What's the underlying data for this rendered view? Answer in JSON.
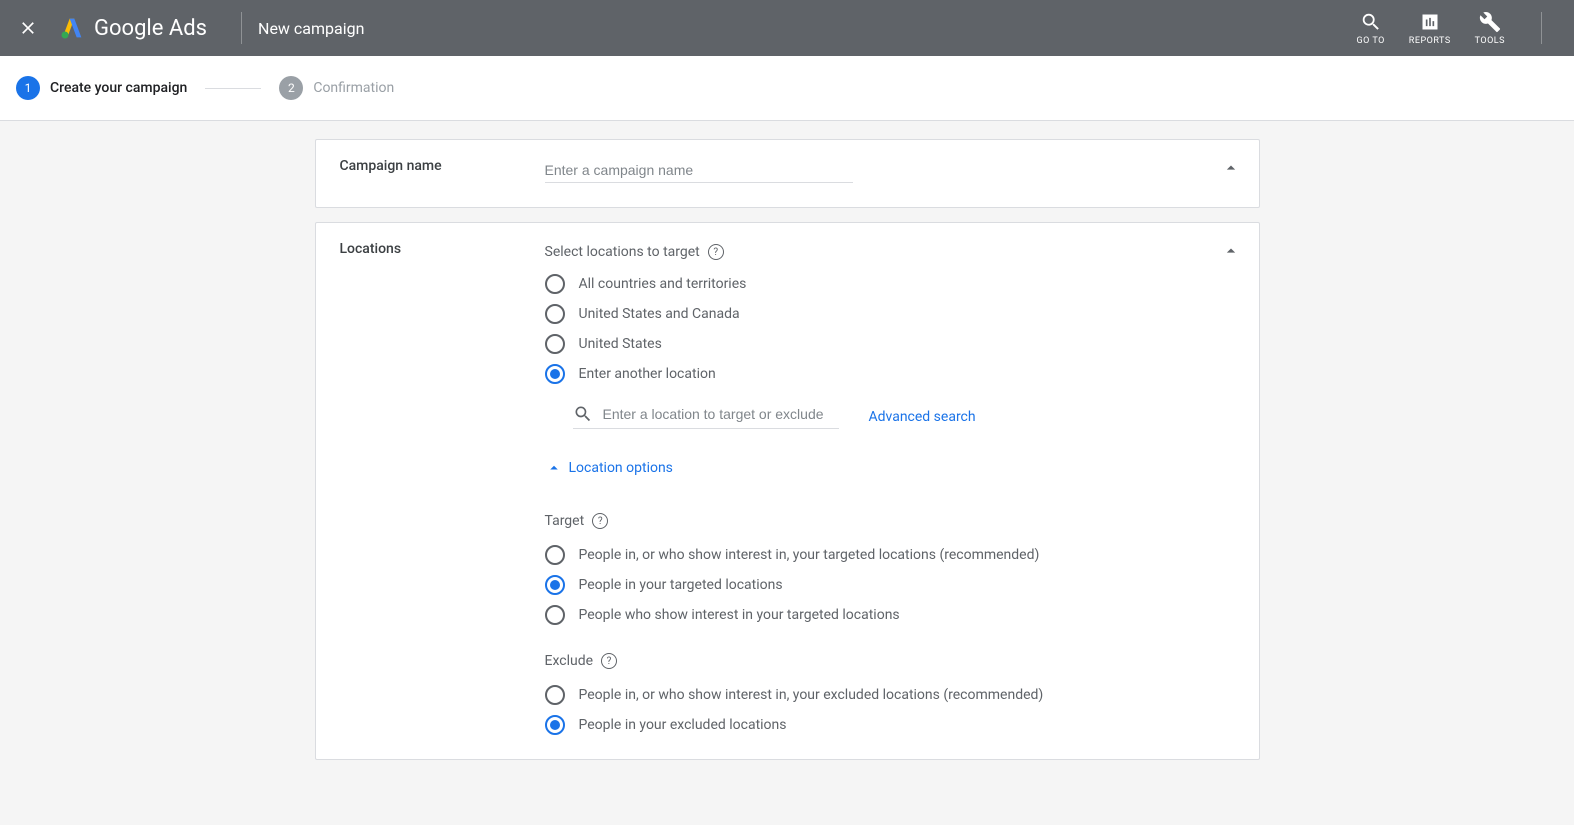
{
  "header": {
    "logo_text": "Google Ads",
    "page_title": "New campaign",
    "actions": {
      "goto": "GO TO",
      "reports": "REPORTS",
      "tools": "TOOLS"
    }
  },
  "stepper": {
    "step1": {
      "number": "1",
      "label": "Create your campaign"
    },
    "step2": {
      "number": "2",
      "label": "Confirmation"
    }
  },
  "campaign_name_card": {
    "title": "Campaign name",
    "placeholder": "Enter a campaign name"
  },
  "locations_card": {
    "title": "Locations",
    "select_label": "Select locations to target",
    "options": [
      {
        "label": "All countries and territories",
        "selected": false
      },
      {
        "label": "United States and Canada",
        "selected": false
      },
      {
        "label": "United States",
        "selected": false
      },
      {
        "label": "Enter another location",
        "selected": true
      }
    ],
    "search_placeholder": "Enter a location to target or exclude",
    "advanced_search": "Advanced search",
    "location_options_label": "Location options",
    "target_label": "Target",
    "target_options": [
      {
        "label": "People in, or who show interest in, your targeted locations (recommended)",
        "selected": false
      },
      {
        "label": "People in your targeted locations",
        "selected": true
      },
      {
        "label": "People who show interest in your targeted locations",
        "selected": false
      }
    ],
    "exclude_label": "Exclude",
    "exclude_options": [
      {
        "label": "People in, or who show interest in, your excluded locations (recommended)",
        "selected": false
      },
      {
        "label": "People in your excluded locations",
        "selected": true
      }
    ]
  }
}
